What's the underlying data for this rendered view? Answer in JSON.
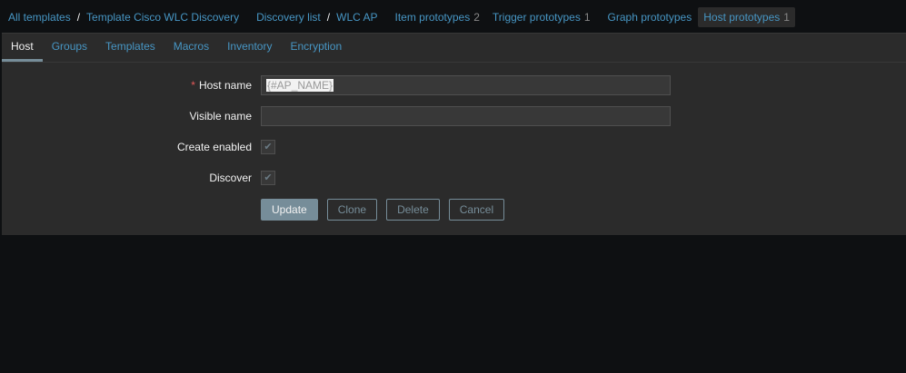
{
  "breadcrumb": {
    "all_templates": "All templates",
    "template": "Template Cisco WLC Discovery",
    "discovery_list": "Discovery list",
    "rule": "WLC AP",
    "separator": "/",
    "item_prototypes": {
      "label": "Item prototypes",
      "count": "2"
    },
    "trigger_prototypes": {
      "label": "Trigger prototypes",
      "count": "1"
    },
    "graph_prototypes": {
      "label": "Graph prototypes"
    },
    "host_prototypes": {
      "label": "Host prototypes",
      "count": "1"
    }
  },
  "tabs": [
    "Host",
    "Groups",
    "Templates",
    "Macros",
    "Inventory",
    "Encryption"
  ],
  "form": {
    "host_name": {
      "label": "Host name",
      "required": "*",
      "value": "{#AP_NAME}"
    },
    "visible_name": {
      "label": "Visible name",
      "value": ""
    },
    "create_enabled": {
      "label": "Create enabled",
      "checked": true,
      "icon": "check-icon"
    },
    "discover": {
      "label": "Discover",
      "checked": true,
      "icon": "check-icon"
    }
  },
  "buttons": {
    "update": "Update",
    "clone": "Clone",
    "delete": "Delete",
    "cancel": "Cancel"
  },
  "colors": {
    "link": "#4796c4",
    "accent": "#768d99",
    "required": "#e45959"
  }
}
